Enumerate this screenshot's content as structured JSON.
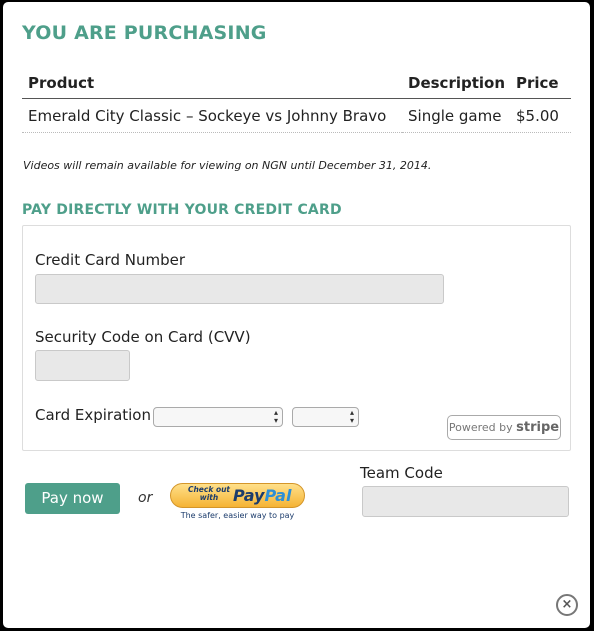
{
  "header": {
    "title": "YOU ARE PURCHASING"
  },
  "table": {
    "columns": [
      "Product",
      "Description",
      "Price"
    ],
    "rows": [
      {
        "product": "Emerald City Classic – Sockeye vs Johnny Bravo",
        "description": "Single game",
        "price": "$5.00"
      }
    ]
  },
  "note": "Videos will remain available for viewing on NGN until December 31, 2014.",
  "payment": {
    "title": "PAY DIRECTLY WITH YOUR CREDIT CARD",
    "card_number_label": "Credit Card Number",
    "cvv_label": "Security Code on Card (CVV)",
    "expiration_label": "Card Expiration",
    "stripe_prefix": "Powered by",
    "stripe_brand": "stripe"
  },
  "actions": {
    "pay_now_label": "Pay now",
    "or_label": "or",
    "paypal": {
      "checkout_text": "Check out with",
      "brand_pay": "Pay",
      "brand_pal": "Pal",
      "tagline": "The safer, easier way to pay"
    }
  },
  "team_code": {
    "label": "Team Code"
  },
  "close": {
    "symbol": "×"
  },
  "colors": {
    "accent": "#4e9f8a",
    "overlay": "#000000"
  }
}
